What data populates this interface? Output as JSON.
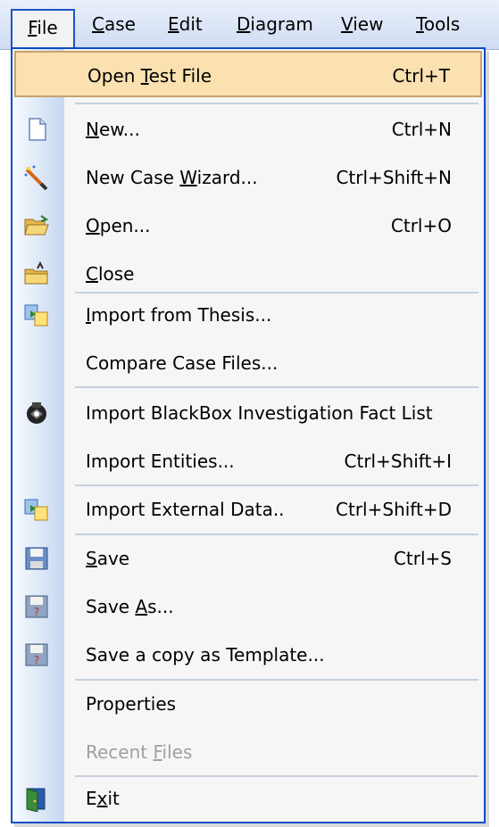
{
  "menubar": {
    "items": [
      {
        "text": "File",
        "accel": "F",
        "rest": "ile"
      },
      {
        "text": "Case",
        "accel": "C",
        "rest": "ase"
      },
      {
        "text": "Edit",
        "accel": "E",
        "rest": "dit"
      },
      {
        "text": "Diagram",
        "accel": "D",
        "rest": "iagram"
      },
      {
        "text": "View",
        "accel": "V",
        "rest": "iew"
      },
      {
        "text": "Tools",
        "accel": "T",
        "rest": "ools"
      }
    ]
  },
  "menu": {
    "items": [
      {
        "pre": "Open ",
        "ul": "T",
        "post": "est File",
        "shortcut": "Ctrl+T",
        "icon": "none",
        "highlight": true
      },
      {
        "pre": "",
        "ul": "N",
        "post": "ew...",
        "shortcut": "Ctrl+N",
        "icon": "new-document-icon"
      },
      {
        "pre": "New Case ",
        "ul": "W",
        "post": "izard...",
        "shortcut": "Ctrl+Shift+N",
        "icon": "wizard-wand-icon"
      },
      {
        "pre": "",
        "ul": "O",
        "post": "pen...",
        "shortcut": "Ctrl+O",
        "icon": "open-folder-icon"
      },
      {
        "pre": "",
        "ul": "C",
        "post": "lose",
        "shortcut": "",
        "icon": "close-folder-icon"
      },
      {
        "pre": "",
        "ul": "I",
        "post": "mport from Thesis...",
        "shortcut": "",
        "icon": "import-icon"
      },
      {
        "pre": "Compare Case Files...",
        "ul": "",
        "post": "",
        "shortcut": "",
        "icon": "none"
      },
      {
        "pre": "Import BlackBox Investigation Fact List",
        "ul": "",
        "post": "",
        "shortcut": "",
        "icon": "blackbox-icon"
      },
      {
        "pre": "Import Entities...",
        "ul": "",
        "post": "",
        "shortcut": "Ctrl+Shift+I",
        "icon": "none"
      },
      {
        "pre": "Import External Data..",
        "ul": "",
        "post": "",
        "shortcut": "Ctrl+Shift+D",
        "icon": "import-icon"
      },
      {
        "pre": "",
        "ul": "S",
        "post": "ave",
        "shortcut": "Ctrl+S",
        "icon": "save-disk-icon"
      },
      {
        "pre": "Save ",
        "ul": "A",
        "post": "s...",
        "shortcut": "",
        "icon": "save-as-icon"
      },
      {
        "pre": "Save a copy as Template...",
        "ul": "",
        "post": "",
        "shortcut": "",
        "icon": "save-template-icon"
      },
      {
        "pre": "Properties",
        "ul": "",
        "post": "",
        "shortcut": "",
        "icon": "none"
      },
      {
        "pre": "Recent ",
        "ul": "F",
        "post": "iles",
        "shortcut": "",
        "icon": "none",
        "disabled": true
      },
      {
        "pre": "E",
        "ul": "x",
        "post": "it",
        "shortcut": "",
        "icon": "exit-door-icon"
      }
    ]
  },
  "colors": {
    "accent": "#0a4bc6",
    "highlight": "#fbe0b0",
    "gutter": "#c6d7f2",
    "disabled_text": "#a0a0a0"
  }
}
